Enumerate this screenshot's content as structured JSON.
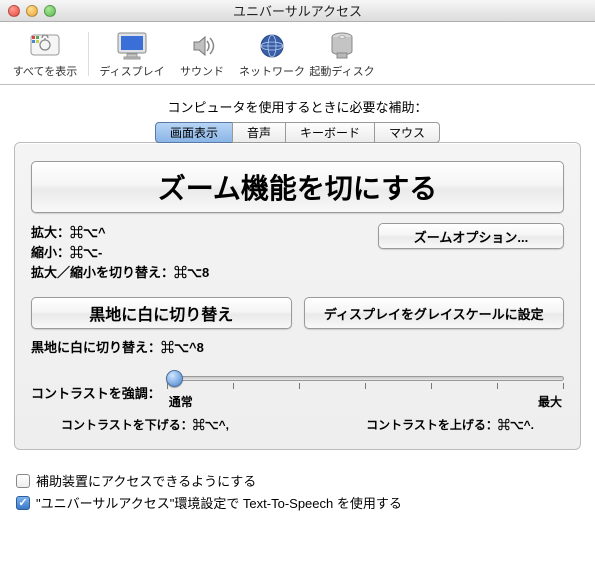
{
  "window": {
    "title": "ユニバーサルアクセス"
  },
  "toolbar": {
    "showall": "すべてを表示",
    "display": "ディスプレイ",
    "sound": "サウンド",
    "network": "ネットワーク",
    "startup": "起動ディスク"
  },
  "heading": "コンピュータを使用するときに必要な補助：",
  "tabs": {
    "seeing": "画面表示",
    "hearing": "音声",
    "keyboard": "キーボード",
    "mouse": "マウス"
  },
  "zoom": {
    "toggle_btn": "ズーム機能を切にする",
    "in": "拡大：⌘⌥^",
    "out": "縮小：⌘⌥-",
    "toggle_sc": "拡大／縮小を切り替え：⌘⌥8",
    "options_btn": "ズームオプション..."
  },
  "display": {
    "invert_btn": "黒地に白に切り替え",
    "grayscale_btn": "ディスプレイをグレイスケールに設定",
    "invert_sc": "黒地に白に切り替え：⌘⌥^8"
  },
  "contrast": {
    "label": "コントラストを強調：",
    "min": "通常",
    "max": "最大",
    "dec": "コントラストを下げる：⌘⌥^,",
    "inc": "コントラストを上げる：⌘⌥^."
  },
  "footer": {
    "assistive": "補助装置にアクセスできるようにする",
    "tts": "\"ユニバーサルアクセス\"環境設定で Text-To-Speech を使用する"
  }
}
